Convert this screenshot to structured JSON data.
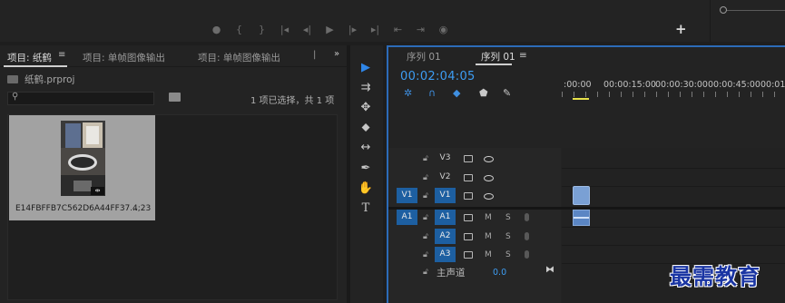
{
  "monitor": {
    "controls": [
      "●",
      "{",
      "}",
      "|◂",
      "◂|",
      "▶",
      "|▸",
      "▸|",
      "⇤",
      "⇥",
      "◉"
    ],
    "add_label": "+"
  },
  "project_panel": {
    "tabs": [
      {
        "label": "项目: 纸鹤",
        "active": true
      },
      {
        "label": "项目: 单帧图像输出",
        "active": false
      },
      {
        "label": "项目: 单帧图像输出",
        "active": false
      }
    ],
    "tab_overflow": "»",
    "project_file": "纸鹤.prproj",
    "search_placeholder": "",
    "selection_count": "1 项已选择，共 1 项",
    "clip": {
      "name": "E14FBFFB7C562D6A44FF37...",
      "duration": "4;23"
    }
  },
  "timeline": {
    "tabs": [
      {
        "label": "序列 01",
        "active": false
      },
      {
        "label": "序列 01",
        "active": true
      }
    ],
    "timecode": "00:02:04:05",
    "ruler_labels": [
      ":00:00",
      "00:00:15:00",
      "00:00:30:00",
      "00:00:45:00",
      "00:01"
    ],
    "video_tracks": [
      {
        "source": "",
        "target": "V3",
        "target_on": false
      },
      {
        "source": "",
        "target": "V2",
        "target_on": false
      },
      {
        "source": "V1",
        "target": "V1",
        "target_on": true
      }
    ],
    "audio_tracks": [
      {
        "source": "A1",
        "target": "A1",
        "target_on": true,
        "m": "M",
        "s": "S"
      },
      {
        "source": "",
        "target": "A2",
        "target_on": true,
        "m": "M",
        "s": "S"
      },
      {
        "source": "",
        "target": "A3",
        "target_on": true,
        "m": "M",
        "s": "S"
      }
    ],
    "master_label": "主声道",
    "master_value": "0.0"
  },
  "tools": [
    "▶",
    "⇉",
    "✥",
    "⬥",
    "↔",
    "✒",
    "✋",
    "T"
  ],
  "watermark": "最需教育",
  "colors": {
    "accent_blue": "#3d9df3",
    "track_target_blue": "#1d5fa1",
    "in_marker_yellow": "#e8e24a"
  }
}
